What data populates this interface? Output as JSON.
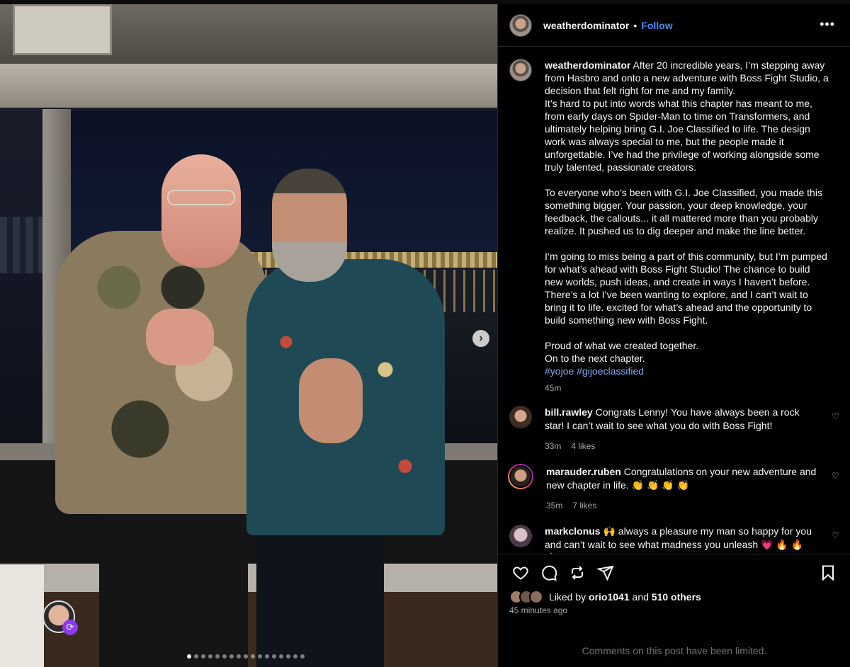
{
  "post": {
    "username": "weatherdominator",
    "separator": "•",
    "follow_label": "Follow",
    "more_label": "•••",
    "caption": {
      "username": "weatherdominator",
      "text": "After 20 incredible years, I’m stepping away from Hasbro and onto a new adventure with Boss Fight Studio, a decision that felt right for me and my family.\nIt’s hard to put into words what this chapter has meant to me, from early days on Spider-Man to time on Transformers, and ultimately helping bring G.I. Joe Classified to life. The design work was always special to me, but the people made it unforgettable. I’ve had the privilege of working alongside some truly talented, passionate creators.\n\nTo everyone who’s been with G.I. Joe Classified, you made this something bigger. Your passion, your deep knowledge, your feedback, the callouts... it all mattered more than you probably realize. It pushed us to dig deeper and make the line better.\n\nI’m going to miss being a part of this community, but I’m pumped for what’s ahead with Boss Fight Studio! The chance to build new worlds, push ideas, and create in ways I haven’t before. There’s a lot I’ve been wanting to explore, and I can’t wait to bring it to life. excited for what’s ahead and the opportunity to build something new with Boss Fight.\n\nProud of what we created together.\nOn to the next chapter.",
      "hashtags": "#yojoe #gijoeclassified",
      "time": "45m"
    },
    "comments": [
      {
        "username": "bill.rawley",
        "text": "Congrats Lenny! You have always been a rock star! I can’t wait to see what you do with Boss Fight!",
        "time": "33m",
        "likes": "4 likes",
        "avatar_color": "#7a5a46"
      },
      {
        "username": "marauder.ruben",
        "text": "Congratulations on your new adventure and new chapter in life. 👏 👏 👏 👏",
        "time": "35m",
        "likes": "7 likes",
        "avatar_color": "#5c4a3e"
      },
      {
        "username": "markclonus",
        "text": "🙌  always a pleasure my man so happy for you and can’t wait to see what madness you unleash 💗 🔥 🔥 🔥",
        "time": "",
        "likes": "",
        "avatar_color": "#6e5a6a"
      }
    ],
    "liked_by": {
      "prefix": "Liked by",
      "user": "orio1041",
      "middle": "and",
      "others": "510 others"
    },
    "time_ago": "45 minutes ago",
    "comments_limited": "Comments on this post have been limited.",
    "carousel": {
      "total_slides": 17,
      "active_index": 0
    },
    "icons": {
      "next": "chevron-right-icon",
      "like": "heart-icon",
      "comment": "comment-icon",
      "repost": "repost-icon",
      "share": "send-icon",
      "save": "bookmark-icon"
    },
    "colors": {
      "accent": "#4a8df8",
      "hashtag": "#88a9f7",
      "background": "#000000"
    }
  }
}
